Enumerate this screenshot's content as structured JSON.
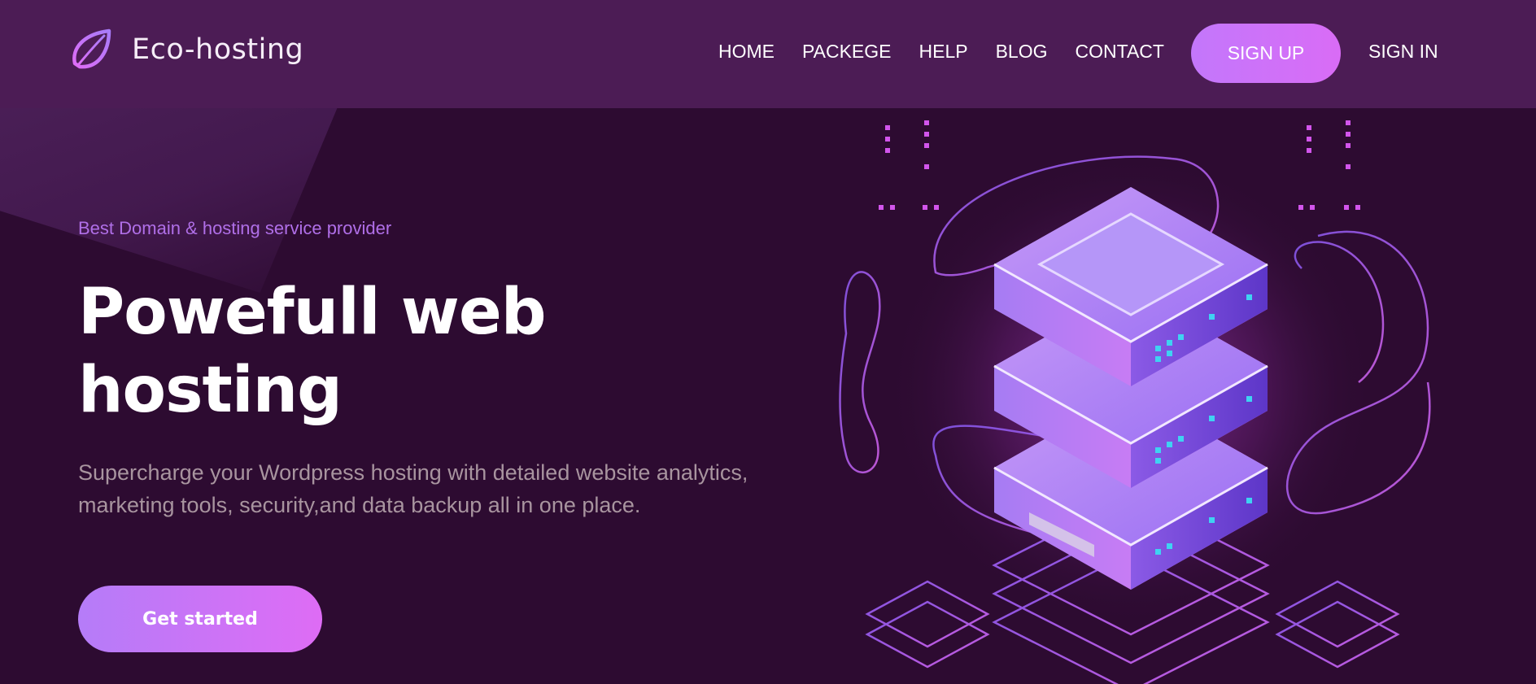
{
  "brand": {
    "name": "Eco-hosting",
    "logo_icon": "leaf-icon"
  },
  "nav": {
    "items": [
      "HOME",
      "PACKEGE",
      "HELP",
      "BLOG",
      "CONTACT"
    ]
  },
  "auth": {
    "signup_label": "SIGN UP",
    "signin_label": "SIGN IN"
  },
  "hero": {
    "eyebrow": "Best Domain & hosting service provider",
    "title_line1": "Powefull web",
    "title_line2": "hosting",
    "description": "Supercharge your Wordpress hosting with detailed website analytics, marketing tools, security,and data backup all in one place.",
    "cta_label": "Get started"
  },
  "colors": {
    "background": "#2d0b31",
    "header": "#4c1c55",
    "accent_start": "#b57cf8",
    "accent_end": "#de6cf5",
    "eyebrow": "#b06fe8",
    "server_light": "#b48cf7",
    "server_dark": "#6a3fd0",
    "indicator": "#3fd2f2"
  },
  "illustration": {
    "icon": "server-stack-icon"
  }
}
